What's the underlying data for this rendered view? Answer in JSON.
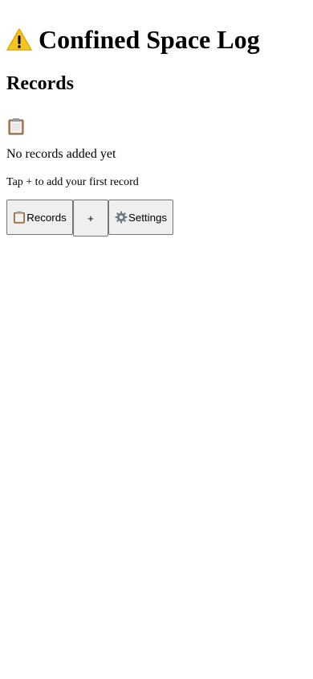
{
  "header": {
    "icon": "warning-icon",
    "title": "Confined Space Log"
  },
  "section": {
    "title": "Records"
  },
  "empty_state": {
    "icon": "clipboard-icon",
    "title": "No records added yet",
    "subtitle": "Tap + to add your first record"
  },
  "nav": {
    "records_icon": "clipboard-icon",
    "records_label": "Records",
    "add_label": "+",
    "settings_icon": "gear-icon",
    "settings_label": "Settings"
  }
}
